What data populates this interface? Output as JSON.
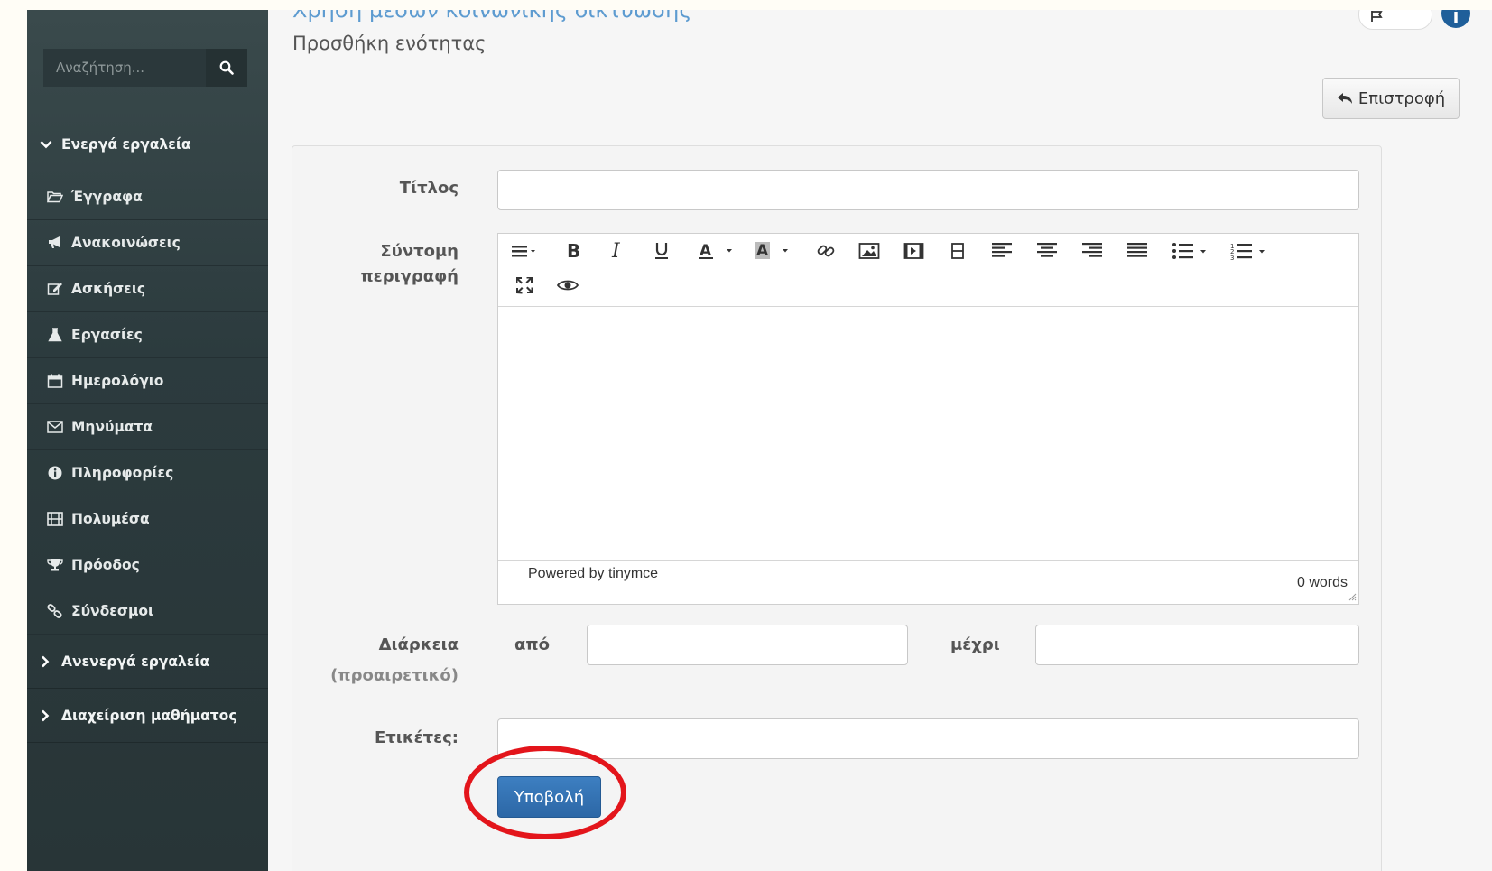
{
  "sidebar": {
    "search_placeholder": "Αναζήτηση...",
    "active_tools_label": "Ενεργά εργαλεία",
    "items": [
      {
        "label": "Έγγραφα",
        "icon": "folder-open-icon"
      },
      {
        "label": "Ανακοινώσεις",
        "icon": "bullhorn-icon"
      },
      {
        "label": "Ασκήσεις",
        "icon": "edit-icon"
      },
      {
        "label": "Εργασίες",
        "icon": "flask-icon"
      },
      {
        "label": "Ημερολόγιο",
        "icon": "calendar-icon"
      },
      {
        "label": "Μηνύματα",
        "icon": "envelope-icon"
      },
      {
        "label": "Πληροφορίες",
        "icon": "info-circle-icon"
      },
      {
        "label": "Πολυμέσα",
        "icon": "film-icon"
      },
      {
        "label": "Πρόοδος",
        "icon": "trophy-icon"
      },
      {
        "label": "Σύνδεσμοι",
        "icon": "link-icon"
      }
    ],
    "inactive_tools_label": "Ανενεργά εργαλεία",
    "course_admin_label": "Διαχείριση μαθήματος"
  },
  "header": {
    "course_title": "Χρήση μέσων κοινωνικής δικτύωσης",
    "page_subtitle": "Προσθήκη ενότητας",
    "back_label": "Επιστροφή"
  },
  "form": {
    "title_label": "Τίτλος",
    "title_value": "",
    "description_label_line1": "Σύντομη",
    "description_label_line2": "περιγραφή",
    "editor_powered": "Powered by tinymce",
    "editor_words": "0 words",
    "duration_label": "Διάρκεια",
    "duration_optional": "(προαιρετικό)",
    "from_label": "από",
    "to_label": "μέχρι",
    "from_value": "",
    "to_value": "",
    "tags_label": "Ετικέτες:",
    "tags_value": "",
    "submit_label": "Υποβολή"
  },
  "colors": {
    "sidebar_bg": "#2c3b3e",
    "link_blue": "#5d9bd0",
    "primary_button": "#2c67a6",
    "highlight_circle": "#e3151b"
  }
}
